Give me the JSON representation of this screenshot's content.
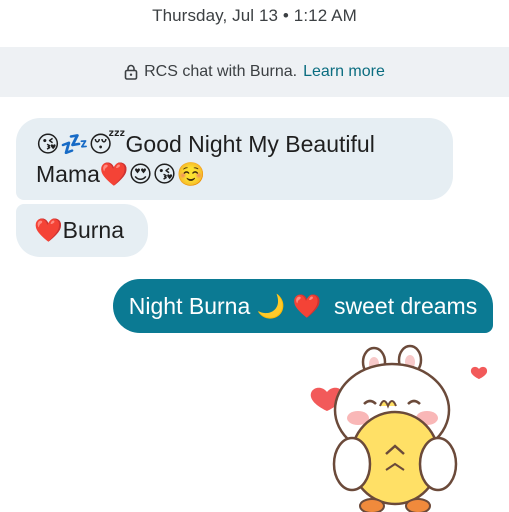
{
  "header": {
    "timestamp": "Thursday, Jul 13 • 1:12 AM"
  },
  "banner": {
    "icon": "lock-icon",
    "text": "RCS chat with Burna.",
    "link": "Learn more"
  },
  "messages": [
    {
      "direction": "incoming",
      "line1_emoji": "😘💤😴",
      "line1_text": "Good Night My Beautiful",
      "line2_text": "Mama",
      "line2_emoji": "❤️😍😘☺️"
    },
    {
      "direction": "incoming",
      "emoji": "❤️",
      "text": "Burna"
    },
    {
      "direction": "outgoing",
      "text_before": "Night Burna",
      "emoji": "🌙 ❤️",
      "text_after": "sweet dreams"
    }
  ],
  "sticker": {
    "icon": "bunny-hugging-chick-sticker"
  },
  "colors": {
    "incoming_bubble": "#e6eef3",
    "outgoing_bubble": "#0b7a93",
    "link": "#0b6d80",
    "banner_bg": "#eef1f4"
  }
}
